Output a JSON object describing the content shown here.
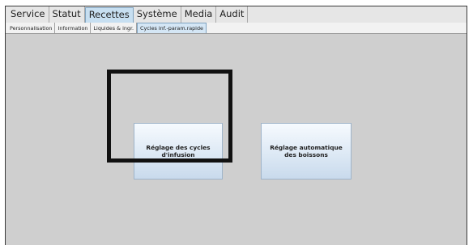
{
  "menu": {
    "items": [
      {
        "label": "Service"
      },
      {
        "label": "Statut"
      },
      {
        "label": "Recettes"
      },
      {
        "label": "Système"
      },
      {
        "label": "Media"
      },
      {
        "label": "Audit"
      }
    ],
    "active_index": 2
  },
  "subtabs": {
    "items": [
      {
        "label": "Personnalisation"
      },
      {
        "label": "Information"
      },
      {
        "label": "Liquides & ingr."
      },
      {
        "label": "Cycles inf.-param.rapide"
      }
    ],
    "active_index": 3
  },
  "main": {
    "buttons": {
      "infusion": {
        "label": "Réglage des cycles d'infusion"
      },
      "boissons": {
        "label": "Réglage automatique des boissons"
      }
    }
  },
  "colors": {
    "active_tab": "#c7dff1",
    "button_gradient_top": "#f6fafe",
    "button_gradient_bottom": "#c9daec",
    "highlight": "#111111",
    "background": "#cfcfcf"
  }
}
